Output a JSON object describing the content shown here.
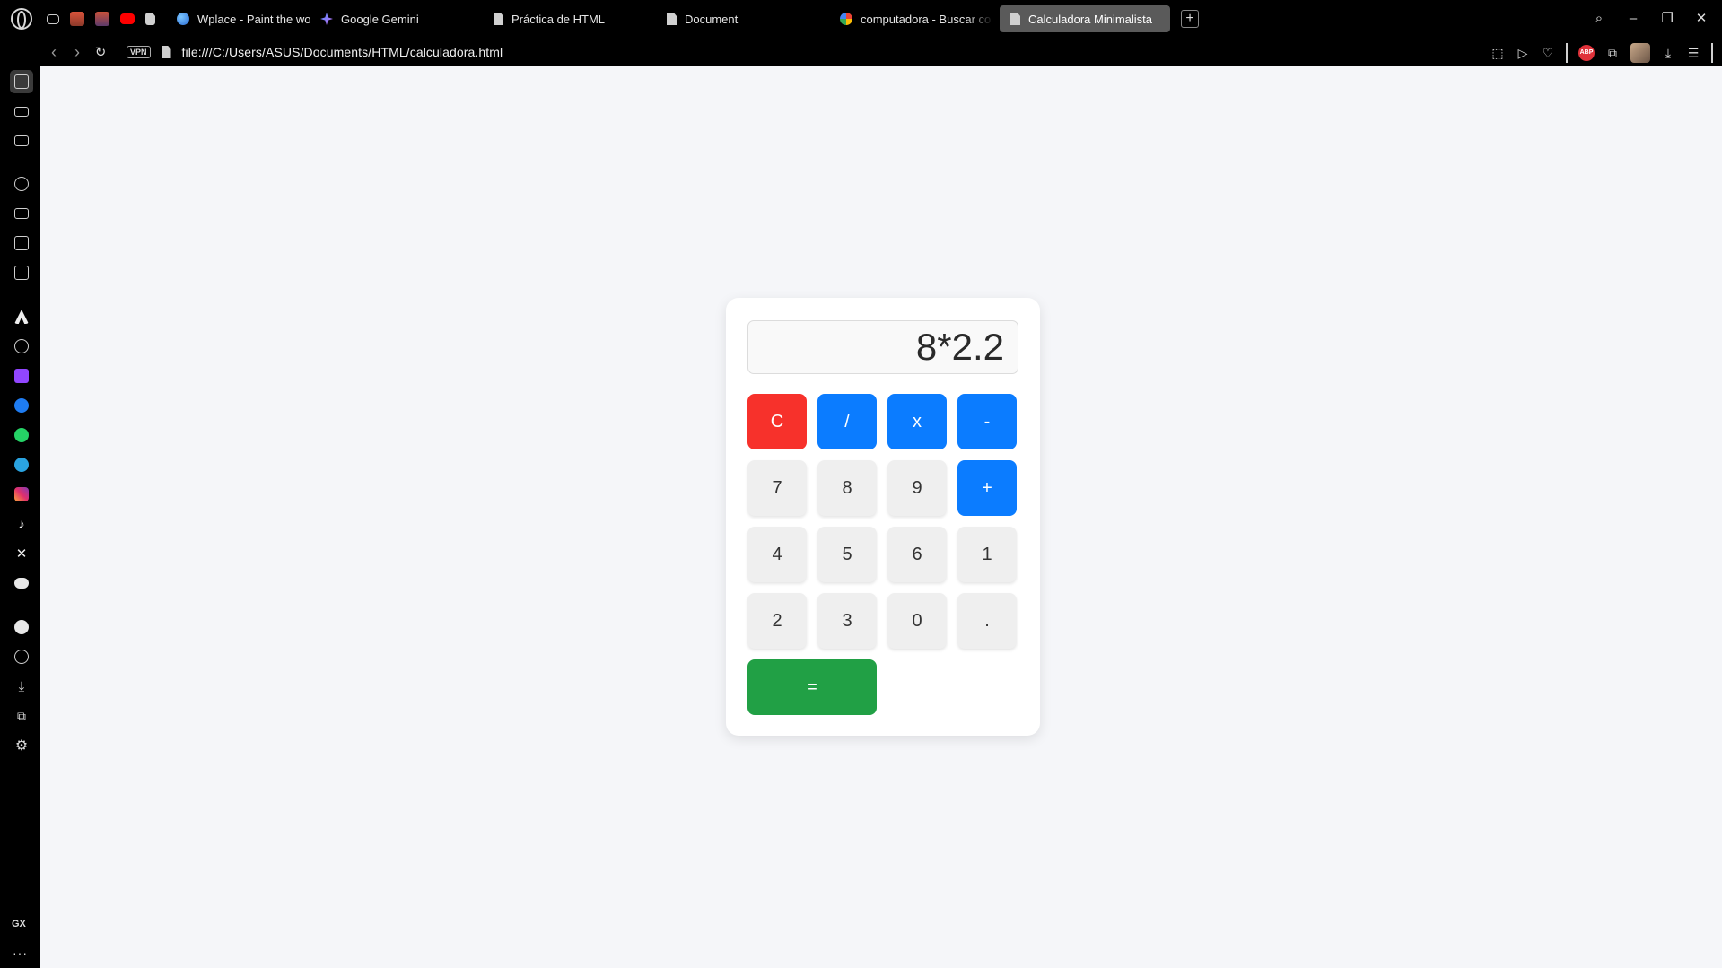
{
  "tabs": [
    {
      "label": "Wplace - Paint the world",
      "icon": "globe-icon"
    },
    {
      "label": "Google Gemini",
      "icon": "gemini-icon"
    },
    {
      "label": "Práctica de HTML",
      "icon": "document-icon"
    },
    {
      "label": "Document",
      "icon": "document-icon"
    },
    {
      "label": "computadora - Buscar co",
      "icon": "google-icon"
    },
    {
      "label": "Calculadora Minimalista",
      "icon": "document-icon",
      "active": true
    }
  ],
  "new_tab": "+",
  "address_bar": {
    "vpn_label": "VPN",
    "url": "file:///C:/Users/ASUS/Documents/HTML/calculadora.html"
  },
  "extensions": {
    "adblock_label": "ABP"
  },
  "sidebar": {
    "gx_label": "GX",
    "more_label": "···"
  },
  "calculator": {
    "display": "8*2.2",
    "keys": {
      "clear": "C",
      "divide": "/",
      "multiply": "x",
      "subtract": "-",
      "seven": "7",
      "eight": "8",
      "nine": "9",
      "add": "+",
      "four": "4",
      "five": "5",
      "six": "6",
      "one": "1",
      "two": "2",
      "three": "3",
      "zero": "0",
      "decimal": ".",
      "equals": "="
    }
  },
  "colors": {
    "operator": "#0b7cff",
    "clear": "#f7312b",
    "equals": "#21a045",
    "number_key": "#efefef",
    "page_background": "#f5f6f9"
  }
}
